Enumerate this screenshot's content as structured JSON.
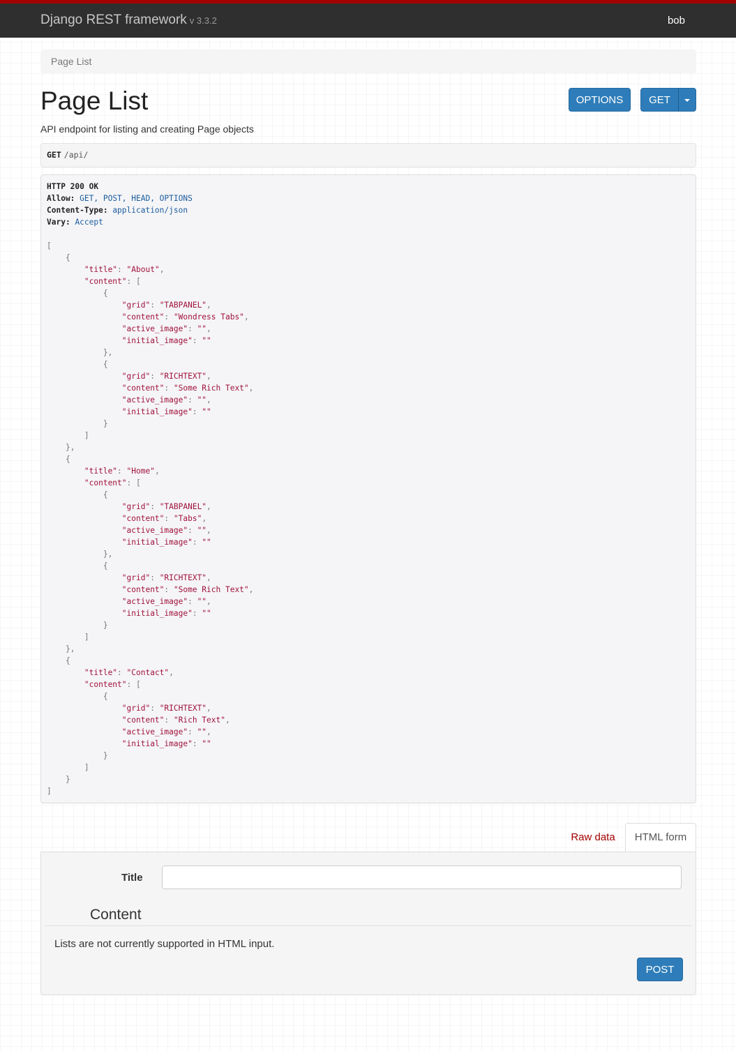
{
  "navbar": {
    "brand": "Django REST framework",
    "version": "v 3.3.2",
    "user": "bob"
  },
  "breadcrumb": "Page List",
  "page": {
    "title": "Page List",
    "description": "API endpoint for listing and creating Page objects"
  },
  "buttons": {
    "options": "OPTIONS",
    "get": "GET",
    "post": "POST"
  },
  "request": {
    "method": "GET",
    "path": "/api/"
  },
  "response": {
    "status": "HTTP 200 OK",
    "headers": [
      {
        "name": "Allow:",
        "value": "GET, POST, HEAD, OPTIONS"
      },
      {
        "name": "Content-Type:",
        "value": "application/json"
      },
      {
        "name": "Vary:",
        "value": "Accept"
      }
    ],
    "body": [
      {
        "title": "About",
        "content": [
          {
            "grid": "TABPANEL",
            "content": "Wondress Tabs",
            "active_image": "",
            "initial_image": ""
          },
          {
            "grid": "RICHTEXT",
            "content": "Some Rich Text",
            "active_image": "",
            "initial_image": ""
          }
        ]
      },
      {
        "title": "Home",
        "content": [
          {
            "grid": "TABPANEL",
            "content": "Tabs",
            "active_image": "",
            "initial_image": ""
          },
          {
            "grid": "RICHTEXT",
            "content": "Some Rich Text",
            "active_image": "",
            "initial_image": ""
          }
        ]
      },
      {
        "title": "Contact",
        "content": [
          {
            "grid": "RICHTEXT",
            "content": "Rich Text",
            "active_image": "",
            "initial_image": ""
          }
        ]
      }
    ]
  },
  "tabs": {
    "raw": "Raw data",
    "html": "HTML form"
  },
  "form": {
    "title_label": "Title",
    "title_value": "",
    "content_legend": "Content",
    "help": "Lists are not currently supported in HTML input."
  },
  "colors": {
    "topbar": "#2f2f2f",
    "accent": "#a30000",
    "button": "#2e7dba"
  }
}
